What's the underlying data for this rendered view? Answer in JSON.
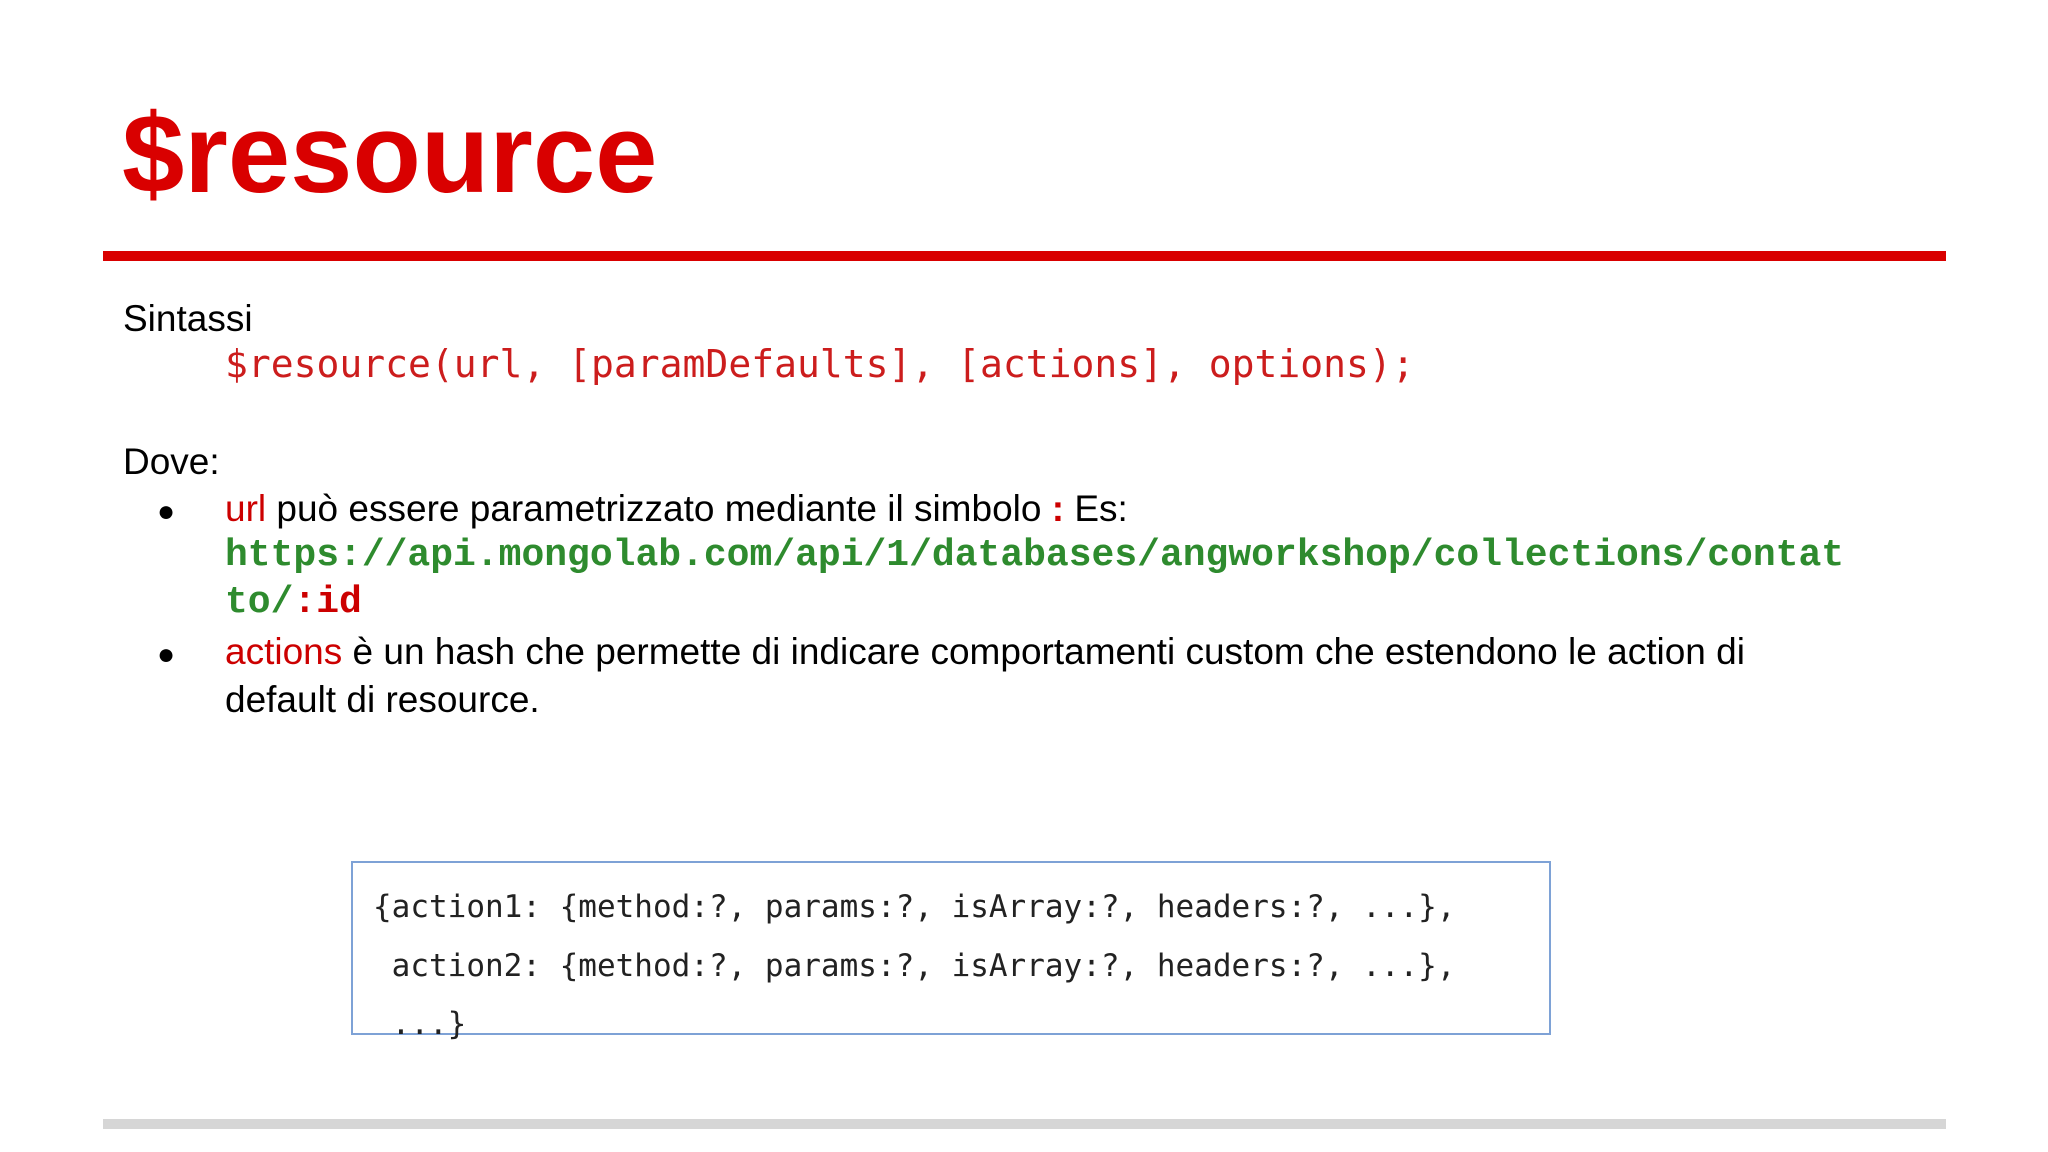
{
  "slide": {
    "title": "$resource",
    "syntax_label": "Sintassi",
    "syntax_code": "$resource(url, [paramDefaults], [actions], options);",
    "where_label": "Dove:",
    "bullets": [
      {
        "keyword": "url",
        "text": " può essere parametrizzato mediante il simbolo ",
        "symbol": ":",
        "text_after": " Es:",
        "example_url_line1": "https://api.mongolab.com/api/1/databases/angworkshop/collections/contat",
        "example_url_line2_prefix": "to/",
        "example_url_param": ":id"
      },
      {
        "keyword": "actions",
        "text_line1": " è un hash che permette di indicare comportamenti custom che estendono le action di",
        "text_line2": "default di resource."
      }
    ],
    "code_box": {
      "line1": "{action1: {method:?, params:?, isArray:?, headers:?, ...},",
      "line2": " action2: {method:?, params:?, isArray:?, headers:?, ...},",
      "line3": " ...}"
    },
    "colors": {
      "accent_red": "#d90000",
      "code_green": "#2e8b2e",
      "box_border": "#7ea2d6"
    }
  }
}
